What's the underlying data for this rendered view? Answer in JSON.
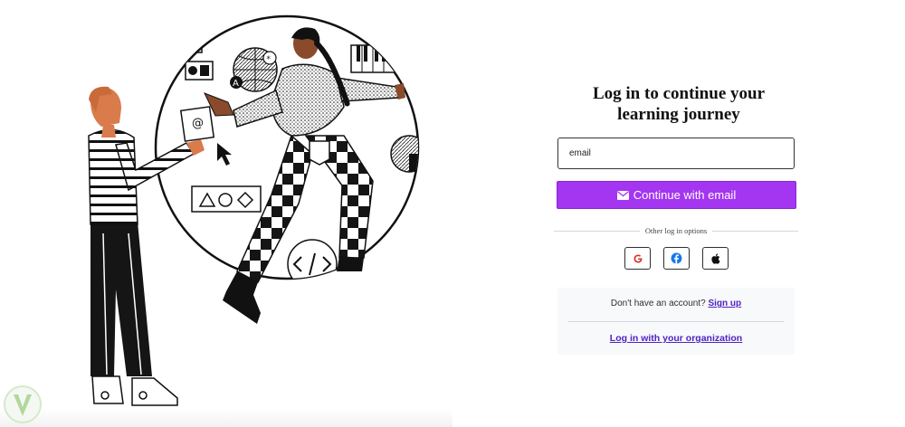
{
  "login": {
    "title_line1": "Log in to continue your",
    "title_line2": "learning journey",
    "email_placeholder": "email",
    "continue_label": "Continue with email",
    "other_options_label": "Other log in options",
    "social": [
      {
        "name": "google",
        "icon": "google-icon",
        "glyph": "G",
        "color": "#d93025"
      },
      {
        "name": "facebook",
        "icon": "facebook-icon",
        "glyph": "f",
        "color": "#1877f2"
      },
      {
        "name": "apple",
        "icon": "apple-icon",
        "glyph": "",
        "color": "#000000"
      }
    ],
    "no_account_text": "Don't have an account?",
    "signup_label": "Sign up",
    "org_login_label": "Log in with your organization"
  },
  "theme": {
    "accent": "#a435f0",
    "link": "#5022c3",
    "panel_bg": "#f7f9fa",
    "skin_orange": "#d97b4a",
    "skin_brown": "#8a4a2c"
  },
  "illustration": {
    "circle_icons": [
      "envelope-at-icon",
      "cursor-icon",
      "globe-icon",
      "piano-keys-icon",
      "code-icon",
      "shapes-icon",
      "letter-a-icon"
    ]
  }
}
